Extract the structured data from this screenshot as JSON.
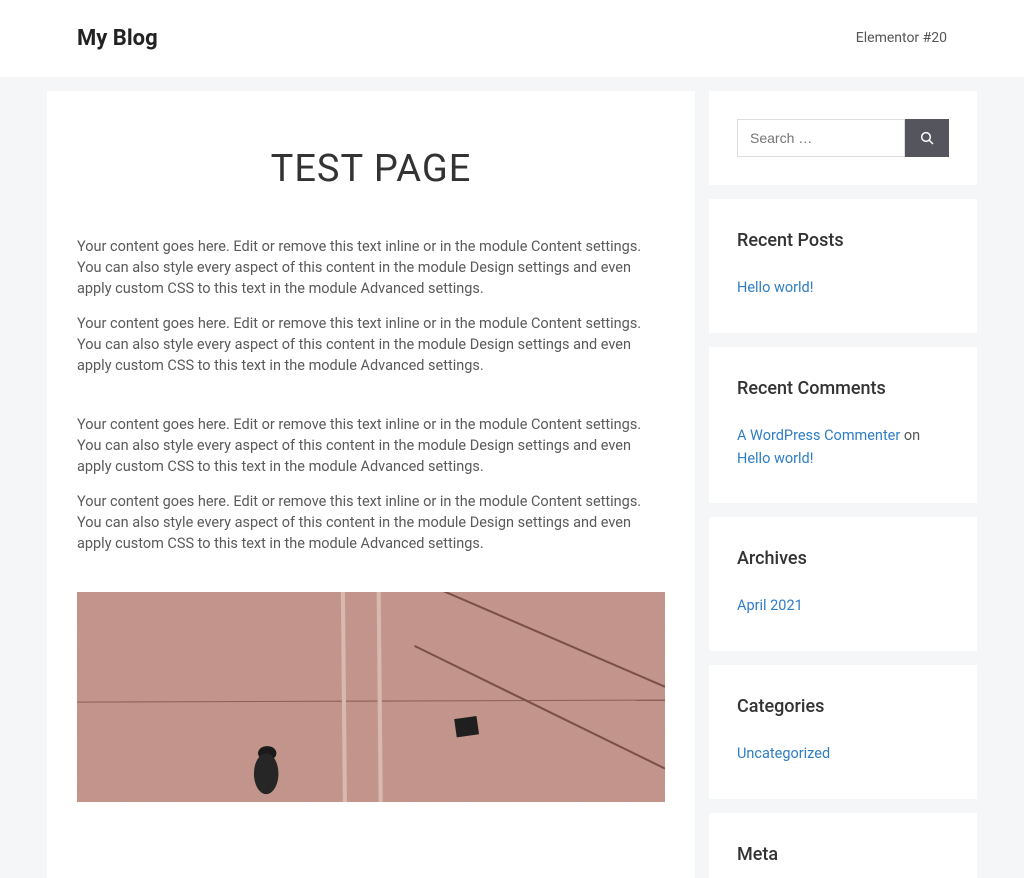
{
  "header": {
    "site_title": "My Blog",
    "nav_item": "Elementor #20"
  },
  "main": {
    "page_title": "TEST PAGE",
    "paragraph": "Your content goes here. Edit or remove this text inline or in the module Content settings. You can also style every aspect of this content in the module Design settings and even apply custom CSS to this text in the module Advanced settings."
  },
  "sidebar": {
    "search": {
      "placeholder": "Search …"
    },
    "recent_posts": {
      "title": "Recent Posts",
      "items": [
        "Hello world!"
      ]
    },
    "recent_comments": {
      "title": "Recent Comments",
      "commenter": "A WordPress Commenter",
      "on": " on ",
      "post": "Hello world!"
    },
    "archives": {
      "title": "Archives",
      "items": [
        "April 2021"
      ]
    },
    "categories": {
      "title": "Categories",
      "items": [
        "Uncategorized"
      ]
    },
    "meta": {
      "title": "Meta"
    }
  }
}
